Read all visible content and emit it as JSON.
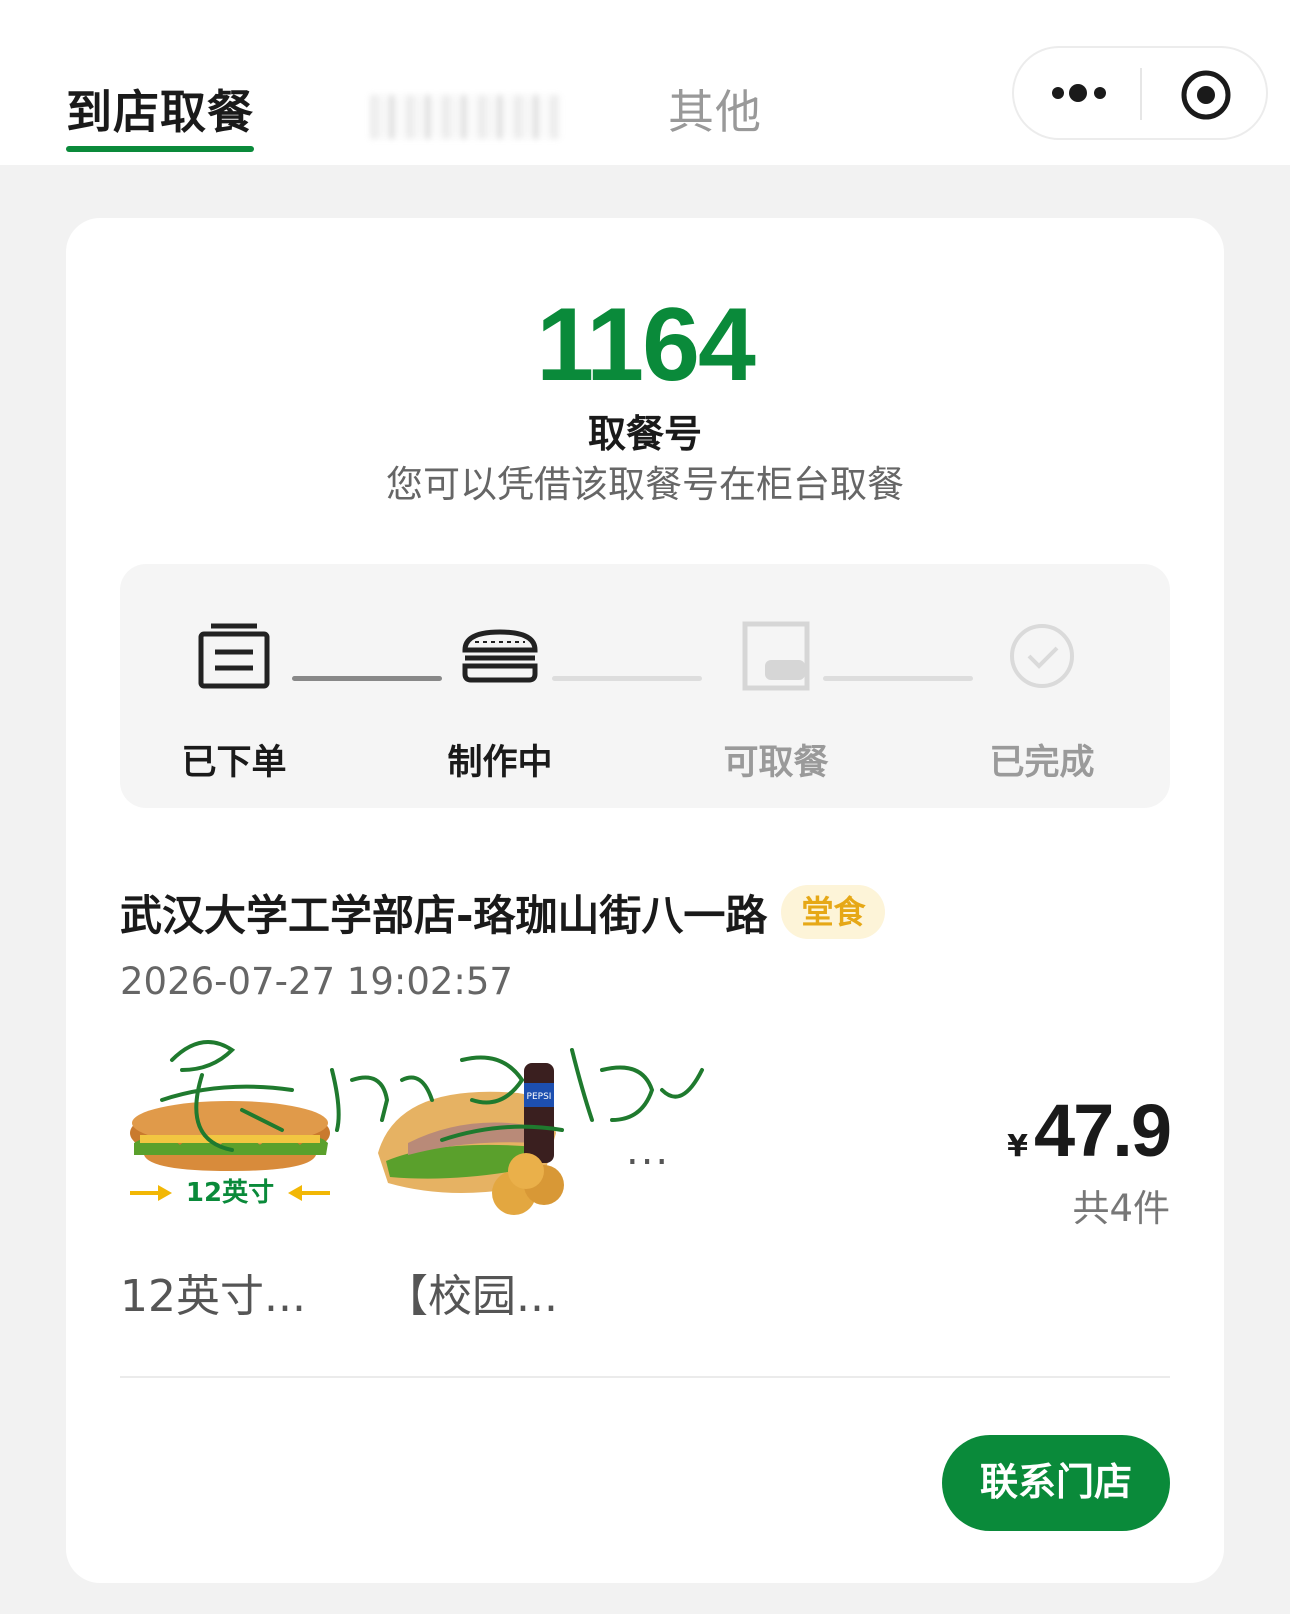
{
  "tabs": {
    "active": "到店取餐",
    "other": "其他"
  },
  "pickup": {
    "number": "1164",
    "label": "取餐号",
    "hint": "您可以凭借该取餐号在柜台取餐"
  },
  "progress": {
    "steps": [
      {
        "label": "已下单",
        "icon": "receipt-icon",
        "state": "done"
      },
      {
        "label": "制作中",
        "icon": "burger-icon",
        "state": "done"
      },
      {
        "label": "可取餐",
        "icon": "food-bag-icon",
        "state": "pending"
      },
      {
        "label": "已完成",
        "icon": "check-circle-icon",
        "state": "pending"
      }
    ]
  },
  "order": {
    "store": "武汉大学工学部店-珞珈山街八一路",
    "tag": "堂食",
    "time": "2026-07-27 19:02:57",
    "items": [
      {
        "name": "12英寸...",
        "badge": "12英寸"
      },
      {
        "name": "【校园..."
      }
    ],
    "more": "...",
    "currency": "¥",
    "price": "47.9",
    "count": "共4件",
    "drink_brand": "PEPSI"
  },
  "actions": {
    "contact": "联系门店"
  },
  "colors": {
    "brand_green": "#0a8a3a",
    "tag_yellow": "#e6a817",
    "badge_yellow": "#f2b705"
  }
}
